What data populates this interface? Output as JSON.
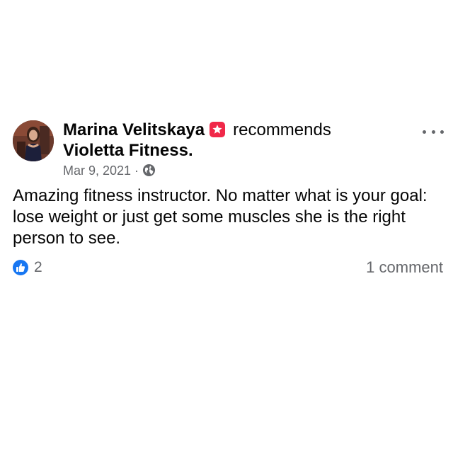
{
  "post": {
    "author": "Marina Velitskaya",
    "action": "recommends",
    "page": "Violetta Fitness.",
    "date": "Mar 9, 2021 ·",
    "privacy_icon": "globe-icon",
    "badge_icon": "star-badge-icon",
    "text": "Amazing fitness instructor. No matter what is your goal: lose weight or just get some muscles she is the right person to see.",
    "reactions": {
      "icon": "like-icon",
      "count": "2"
    },
    "comments": "1 comment",
    "more_icon": "more-options-icon"
  },
  "colors": {
    "text_primary": "#050505",
    "text_secondary": "#65676b",
    "like_blue": "#1877f2",
    "badge_pink": "#f02849"
  }
}
